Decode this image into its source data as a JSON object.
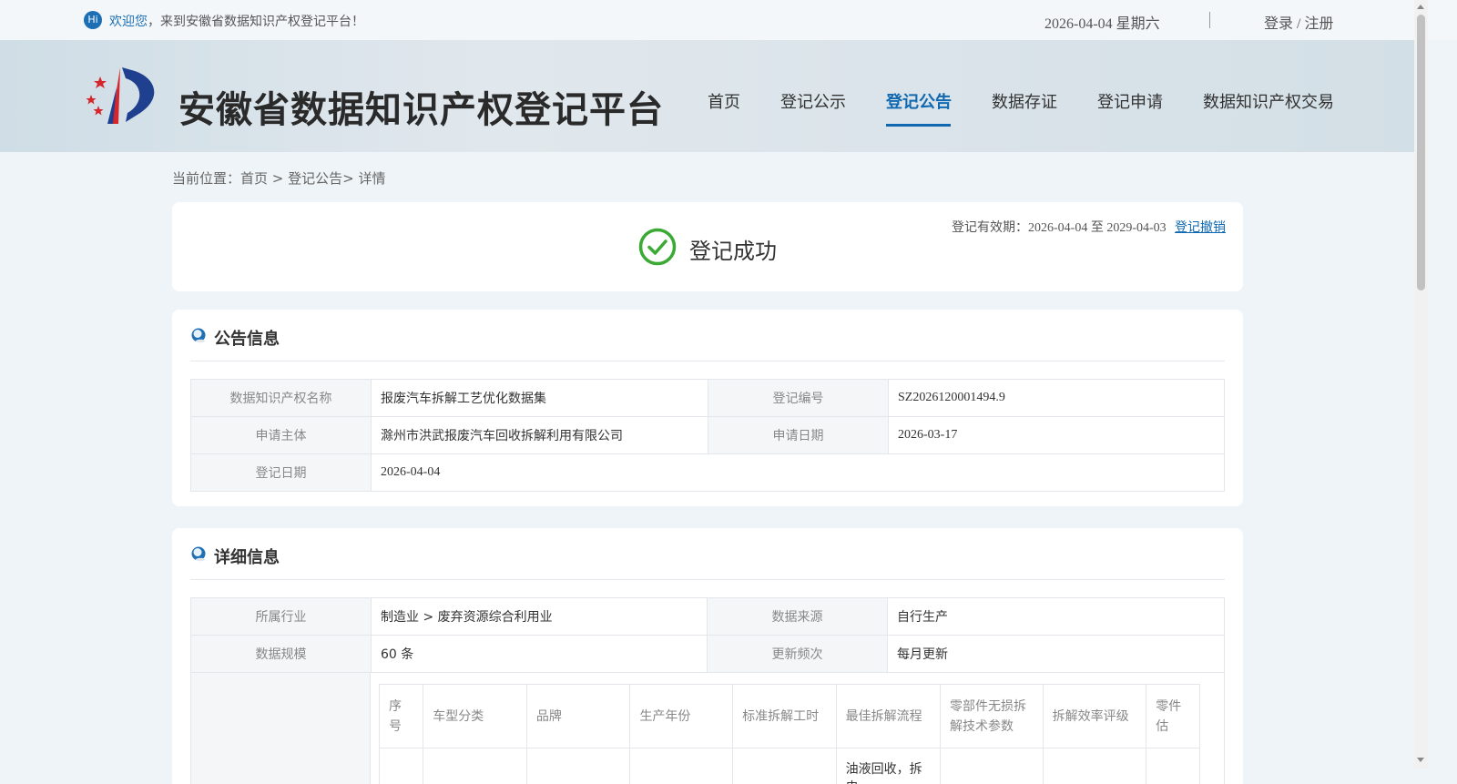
{
  "topbar": {
    "hi_badge": "Hi",
    "welcome_highlight": "欢迎您",
    "welcome_rest": "，来到安徽省数据知识产权登记平台！",
    "date": "2026-04-04 星期六",
    "login": "登录 / 注册"
  },
  "header": {
    "site_title": "安徽省数据知识产权登记平台",
    "nav": [
      "首页",
      "登记公示",
      "登记公告",
      "数据存证",
      "登记申请",
      "数据知识产权交易"
    ],
    "active_nav": "登记公告"
  },
  "breadcrumb": "当前位置：首页 > 登记公告> 详情",
  "status": {
    "validity": "登记有效期：2026-04-04 至 2029-04-03",
    "revoke": "登记撤销",
    "success": "登记成功",
    "success_color": "#3aaa35"
  },
  "notice": {
    "title": "公告信息",
    "rows": [
      [
        {
          "k": "数据知识产权名称",
          "v": "报废汽车拆解工艺优化数据集"
        },
        {
          "k": "登记编号",
          "v": "SZ2026120001494.9"
        }
      ],
      [
        {
          "k": "申请主体",
          "v": "滁州市洪武报废汽车回收拆解利用有限公司"
        },
        {
          "k": "申请日期",
          "v": "2026-03-17"
        }
      ],
      [
        {
          "k": "登记日期",
          "v": "2026-04-04"
        }
      ]
    ]
  },
  "detail": {
    "title": "详细信息",
    "rows": [
      [
        {
          "k": "所属行业",
          "v": "制造业 > 废弃资源综合利用业"
        },
        {
          "k": "数据来源",
          "v": "自行生产"
        }
      ],
      [
        {
          "k": "数据规模",
          "v": "60 条"
        },
        {
          "k": "更新频次",
          "v": "每月更新"
        }
      ]
    ],
    "sample_columns": [
      "序号",
      "车型分类",
      "品牌",
      "生产年份",
      "标准拆解工时",
      "最佳拆解流程",
      "零部件无损拆解技术参数",
      "拆解效率评级",
      "零件估"
    ],
    "sample_first_row_partial": "油液回收，拆电"
  },
  "colors": {
    "accent": "#1068b0",
    "page_bg": "#eff4f8"
  }
}
